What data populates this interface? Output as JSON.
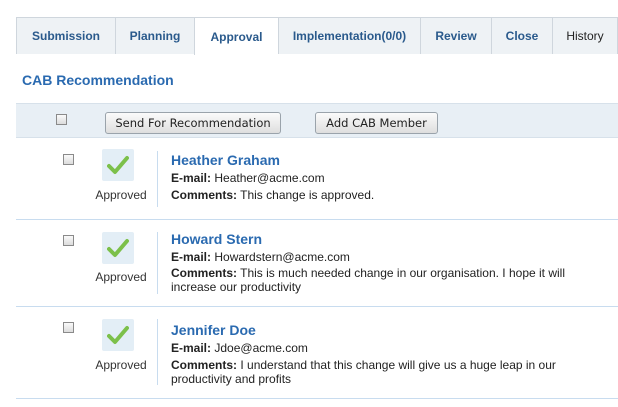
{
  "tabs": [
    {
      "label": "Submission"
    },
    {
      "label": "Planning"
    },
    {
      "label": "Approval"
    },
    {
      "label": "Implementation(0/0)"
    },
    {
      "label": "Review"
    },
    {
      "label": "Close"
    },
    {
      "label": "History"
    }
  ],
  "active_tab": "Approval",
  "section_title": "CAB Recommendation",
  "toolbar": {
    "send_label": "Send For Recommendation",
    "add_member_label": "Add CAB Member"
  },
  "field_labels": {
    "email": "E-mail",
    "comments": "Comments"
  },
  "members": [
    {
      "name": "Heather Graham",
      "email": "Heather@acme.com",
      "comments": "This change is approved.",
      "status": "Approved",
      "status_icon": "check-icon"
    },
    {
      "name": "Howard Stern",
      "email": "Howardstern@acme.com",
      "comments": "This is much needed change in our organisation. I hope it will increase our productivity",
      "status": "Approved",
      "status_icon": "check-icon"
    },
    {
      "name": "Jennifer Doe",
      "email": "Jdoe@acme.com",
      "comments": "I understand that this change will give us a huge leap in our productivity and profits",
      "status": "Approved",
      "status_icon": "check-icon"
    }
  ],
  "colors": {
    "link_blue": "#2a6ab0",
    "tab_bg": "#eef2f5",
    "toolbar_bg": "#e8eff5",
    "check_green": "#7cc04a"
  }
}
